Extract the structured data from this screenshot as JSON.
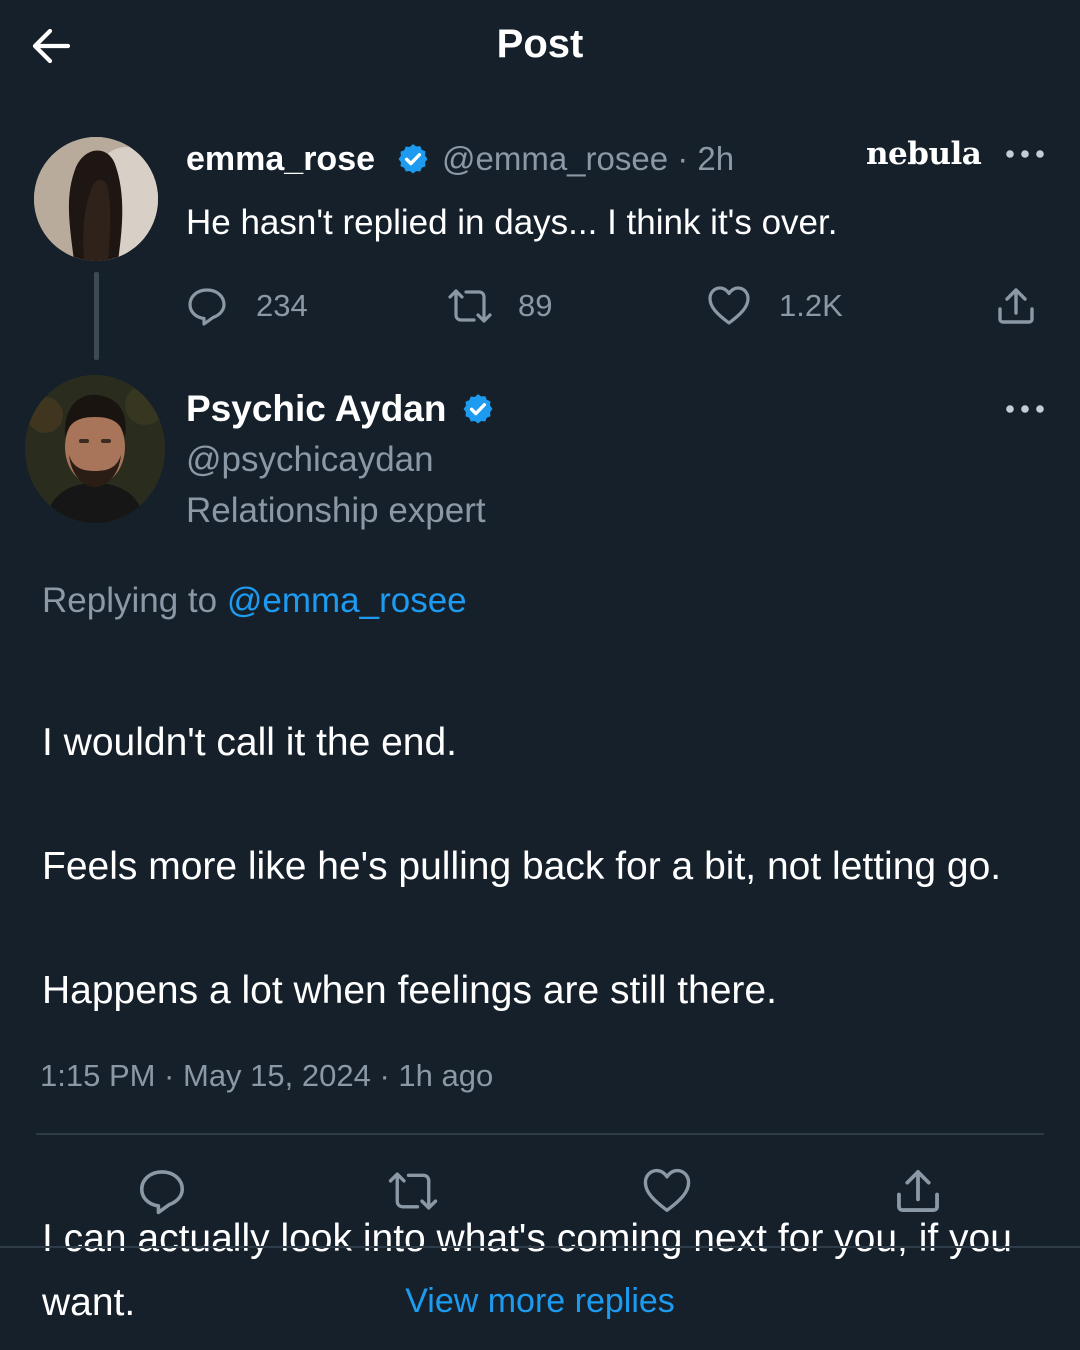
{
  "header": {
    "title": "Post",
    "back_icon": "arrow-left-icon"
  },
  "original_post": {
    "author_name": "emma_rose",
    "handle_time": "@emma_rosee · 2h",
    "watermark": "nebula",
    "text": "He hasn't replied in days... I think it's over.",
    "replies": "234",
    "reposts": "89",
    "likes": "1.2K"
  },
  "reply_post": {
    "author_name": "Psychic Aydan",
    "handle": "@psychicaydan",
    "bio": "Relationship expert",
    "replying_prefix": "Replying to",
    "replying_handle": "@emma_rosee",
    "lines": [
      "I wouldn't call it the end.",
      "Feels more like he's pulling back for a bit, not letting go.",
      "Happens a lot when feelings are still there.",
      "I can actually look into what's coming next for you, if you want."
    ],
    "meta": "1:15 PM · May 15, 2024 · 1h ago"
  },
  "footer": {
    "view_more": "View more replies"
  },
  "colors": {
    "background": "#15202b",
    "accent": "#1d9bf0",
    "muted": "#8b98a5",
    "verified": "#1d9bf0"
  }
}
